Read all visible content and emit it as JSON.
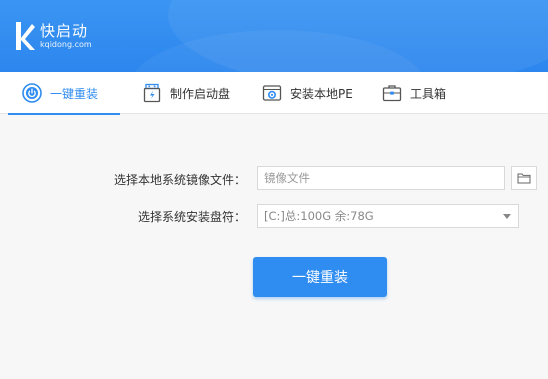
{
  "app": {
    "title": "快启动",
    "subtitle": "kqidong.com"
  },
  "tabs": [
    {
      "label": "一键重装",
      "icon": "power-icon",
      "active": true
    },
    {
      "label": "制作启动盘",
      "icon": "usb-drive-icon",
      "active": false
    },
    {
      "label": "安装本地PE",
      "icon": "pe-install-icon",
      "active": false
    },
    {
      "label": "工具箱",
      "icon": "toolbox-icon",
      "active": false
    }
  ],
  "form": {
    "image_label": "选择本地系统镜像文件：",
    "image_placeholder": "镜像文件",
    "drive_label": "选择系统安装盘符：",
    "drive_value": "[C:]总:100G 余:78G",
    "submit_label": "一键重装"
  },
  "colors": {
    "brand": "#2f8cf0",
    "header": "#3a95f2"
  }
}
